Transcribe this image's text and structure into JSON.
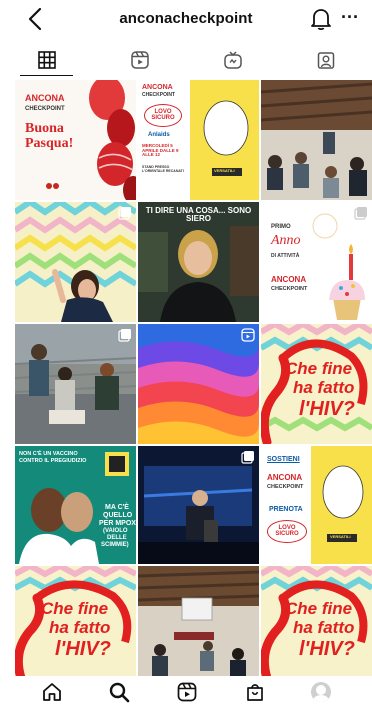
{
  "header": {
    "username": "anconacheckpoint"
  },
  "tabs": [
    {
      "name": "tab-grid",
      "icon": "grid-icon",
      "active": true
    },
    {
      "name": "tab-reels",
      "icon": "reels-icon",
      "active": false
    },
    {
      "name": "tab-igtv",
      "icon": "igtv-icon",
      "active": false
    },
    {
      "name": "tab-tagged",
      "icon": "tagged-icon",
      "active": false
    }
  ],
  "posts": {
    "p1": {
      "brand_top": "ANCONA",
      "brand_bottom": "CHECKPOINT",
      "text": "Buona Pasqua!"
    },
    "p2": {
      "brand_top": "ANCONA",
      "brand_bottom": "CHECKPOINT",
      "lovo": "LOVO SICURO",
      "org": "Anlaids",
      "date": "MERCOLEDÌ 5 APRILE DALLE 9 ALLE 12",
      "place": "STAND PRESSO L'ORIENTALE RECANATI",
      "badge": "VERSATILI"
    },
    "p4_title": "TI DIRE UNA COSA... SONO SIERO",
    "p5": {
      "line1": "PRIMO",
      "line2": "Anno",
      "line3": "DI ATTIVITÀ",
      "brand_top": "ANCONA",
      "brand_bottom": "CHECKPOINT"
    },
    "hiv": {
      "line1": "Che fine",
      "line2": "ha fatto",
      "line3": "l'HIV?"
    },
    "p10": {
      "line1": "NON C'È UN VACCINO",
      "line2": "CONTRO IL PREGIUDIZIO",
      "line3": "MA C'È",
      "line4": "QUELLO",
      "line5": "PER MPOX",
      "line6": "(VAIOLO",
      "line7": "DELLE",
      "line8": "SCIMMIE)"
    },
    "p12": {
      "line1": "SOSTIENI",
      "brand_top": "ANCONA",
      "brand_bottom": "CHECKPOINT",
      "line2": "PRENOTA",
      "line3": "LOVO SICURO",
      "badge": "VERSATILI"
    }
  },
  "colors": {
    "accent_red": "#e1201f",
    "brand_red": "#d6262a",
    "teal": "#138a7a",
    "yellow": "#f7e04a"
  }
}
